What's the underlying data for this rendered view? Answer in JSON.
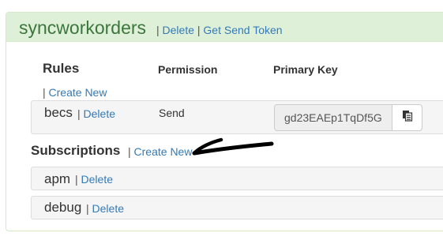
{
  "topic": {
    "title": "syncworkorders",
    "sep1": "|",
    "delete_label": "Delete",
    "sep2": "|",
    "send_token_label": "Get Send Token"
  },
  "rules": {
    "title": "Rules",
    "permission_header": "Permission",
    "primary_key_header": "Primary Key",
    "create_sep": "|",
    "create_label": "Create New",
    "items": [
      {
        "name": "becs",
        "sep": "|",
        "delete_label": "Delete",
        "permission": "Send",
        "primary_key": "gd23EAEp1TqDf5G"
      }
    ]
  },
  "subscriptions": {
    "title": "Subscriptions",
    "create_sep": "|",
    "create_label": "Create New",
    "items": [
      {
        "name": "apm",
        "sep": "|",
        "delete_label": "Delete"
      },
      {
        "name": "debug",
        "sep": "|",
        "delete_label": "Delete"
      }
    ]
  },
  "icons": {
    "copy": "copy-icon",
    "annotation": "hand-drawn-arrow-annotation"
  },
  "colors": {
    "heading_bg": "#dff0d8",
    "heading_border": "#d6e9c6",
    "title_green": "#3c763d",
    "link_blue": "#337ab7",
    "row_bg": "#f5f5f5"
  }
}
